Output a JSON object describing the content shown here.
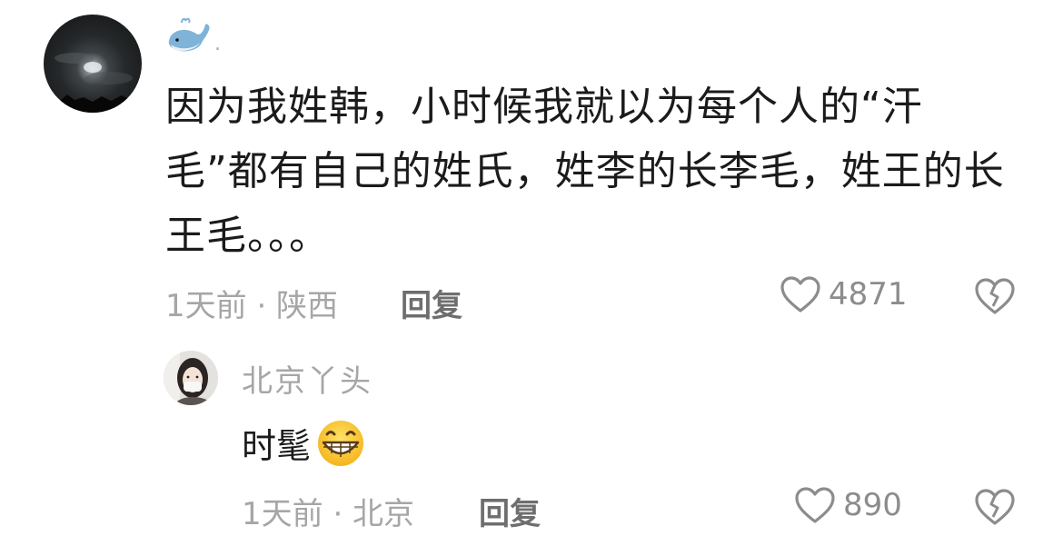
{
  "main_comment": {
    "username": ".",
    "avatar_icon": "moon-clouds-avatar",
    "user_icon": "whale-emoji",
    "text": "因为我姓韩，小时候我就以为每个人的“汗毛”都有自己的姓氏，姓李的长李毛，姓王的长王毛。。。",
    "time_location": "1天前 · 陕西",
    "reply_label": "回复",
    "likes": "4871"
  },
  "reply_comment": {
    "avatar_icon": "girl-mask-avatar",
    "username": "北京丫头",
    "text": "时髦",
    "emoji": "grinning-face-emoji",
    "time_location": "1天前 · 北京",
    "reply_label": "回复",
    "likes": "890"
  },
  "colors": {
    "text": "#1b1b1b",
    "muted": "#a6a6a6",
    "icon": "#8c8c8c"
  }
}
